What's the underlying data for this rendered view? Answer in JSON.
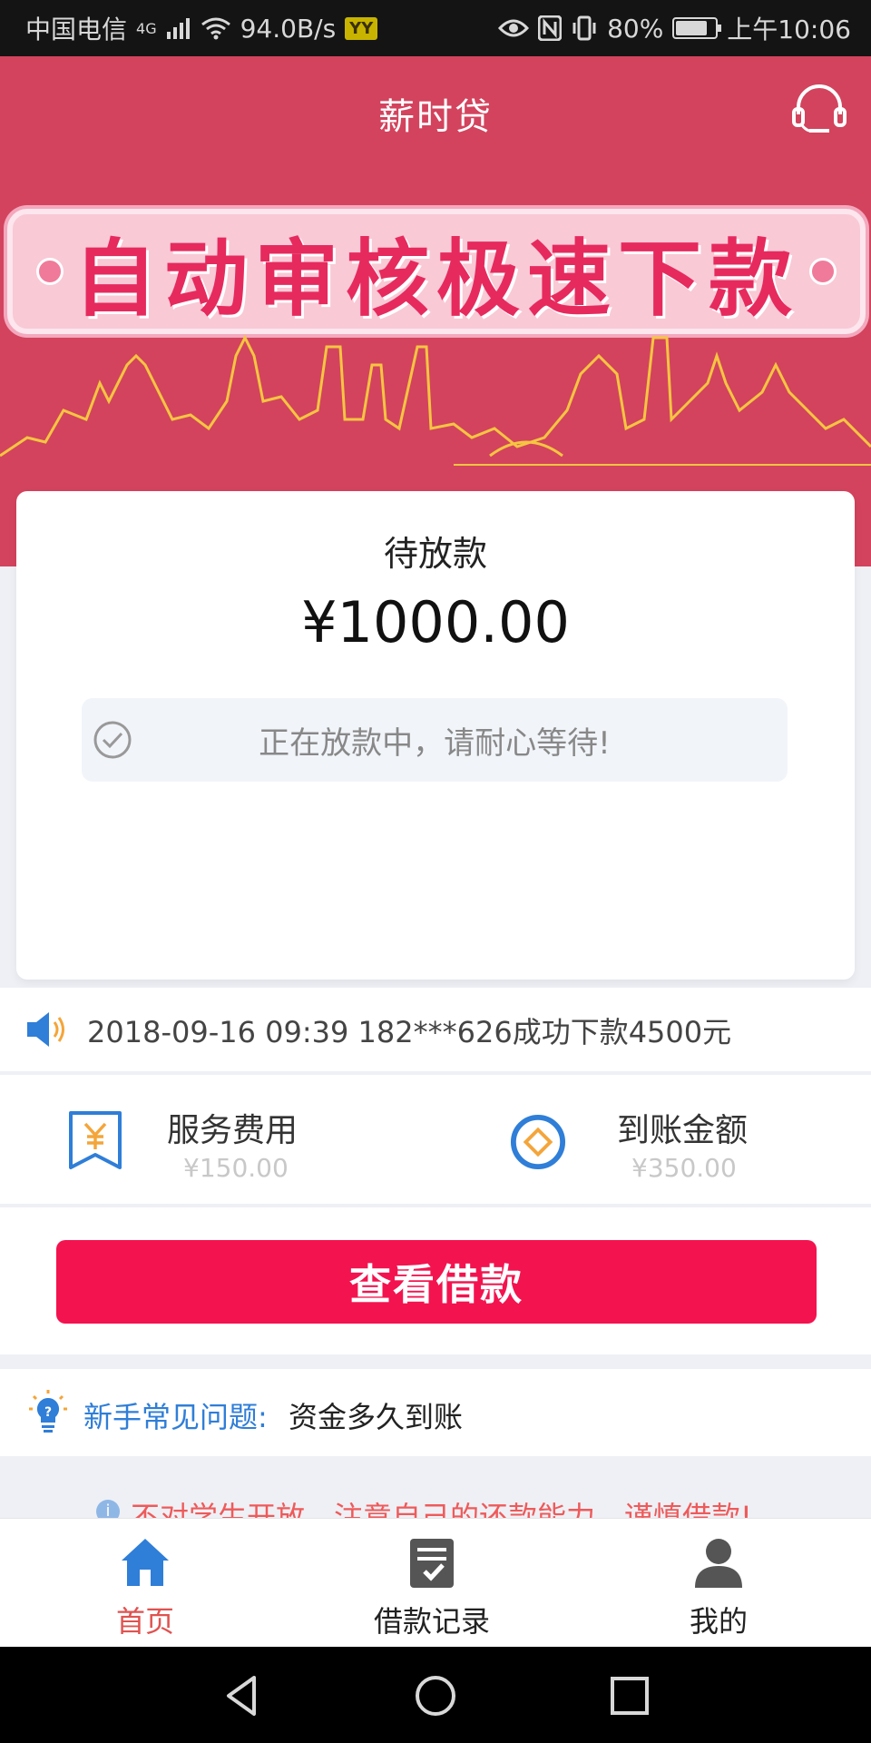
{
  "status_bar": {
    "carrier": "中国电信",
    "network": "4G",
    "speed": "94.0B/s",
    "app_badge": "YY",
    "battery": "80%",
    "battery_level": 0.8,
    "time": "上午10:06"
  },
  "header": {
    "title": "薪时贷",
    "banner_text": "自动审核极速下款",
    "support_icon": "headset-icon",
    "bg_color": "#d3435d"
  },
  "loan_card": {
    "status_title": "待放款",
    "amount": "¥1000.00",
    "status_message": "正在放款中，请耐心等待!"
  },
  "notice": {
    "text": "2018-09-16 09:39 182***626成功下款4500元"
  },
  "fees": [
    {
      "label": "服务费用",
      "value": "¥150.00",
      "icon": "yen-tag-icon"
    },
    {
      "label": "到账金额",
      "value": "¥350.00",
      "icon": "coin-icon"
    }
  ],
  "action": {
    "button_label": "查看借款",
    "button_color": "#f3134f"
  },
  "faq": {
    "label": "新手常见问题:",
    "question": "资金多久到账"
  },
  "warning": {
    "text": "不对学生开放，注意自己的还款能力，谨慎借款!"
  },
  "tab_bar": {
    "items": [
      {
        "label": "首页",
        "icon": "home-icon",
        "active": true
      },
      {
        "label": "借款记录",
        "icon": "clipboard-check-icon",
        "active": false
      },
      {
        "label": "我的",
        "icon": "user-icon",
        "active": false
      }
    ]
  }
}
